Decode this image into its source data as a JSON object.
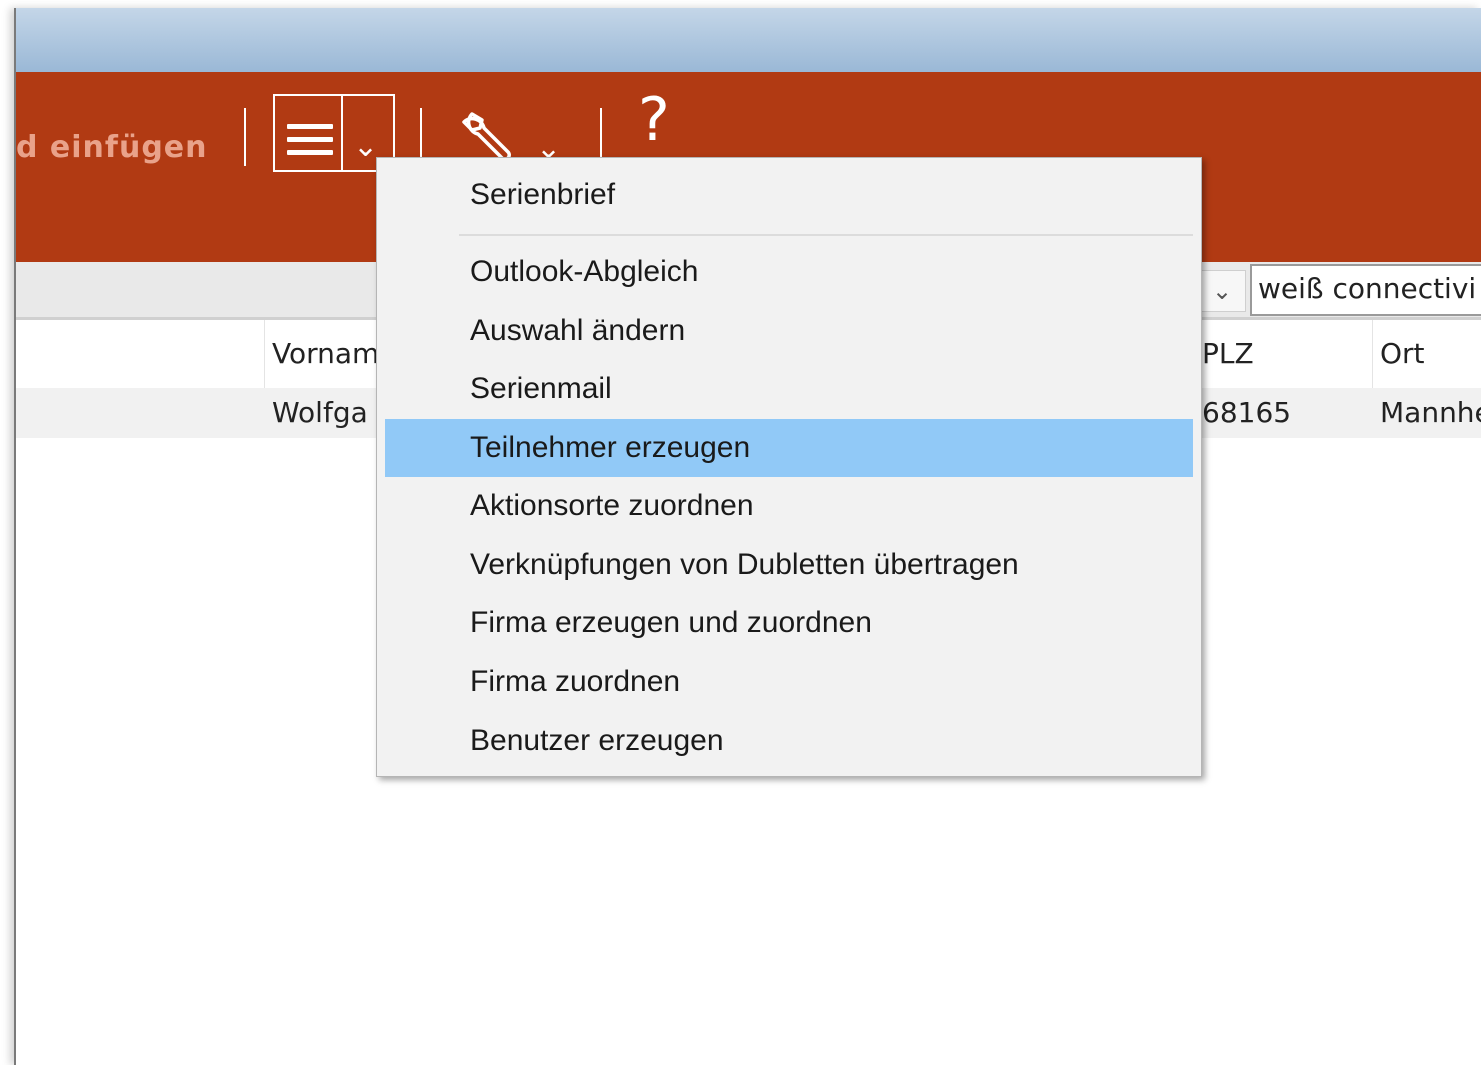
{
  "ribbon": {
    "label": "d einfügen",
    "menu_icon": "hamburger-menu-icon",
    "tools_icon": "wrench-icon",
    "help_label": "?"
  },
  "filter": {
    "dropdown_icon": "chevron-down-icon",
    "search_value": "weiß connectivi"
  },
  "grid": {
    "columns": [
      "Vornam",
      "PLZ",
      "Ort"
    ],
    "rows": [
      [
        "Wolfga",
        "68165",
        "Mannhe"
      ]
    ]
  },
  "popup_menu": {
    "items": [
      {
        "label": "Serienbrief"
      },
      {
        "label": "Outlook-Abgleich"
      },
      {
        "label": "Auswahl ändern"
      },
      {
        "label": "Serienmail"
      },
      {
        "label": "Teilnehmer erzeugen",
        "highlighted": true
      },
      {
        "label": "Aktionsorte zuordnen"
      },
      {
        "label": "Verknüpfungen von Dubletten übertragen"
      },
      {
        "label": "Firma erzeugen und zuordnen"
      },
      {
        "label": "Firma zuordnen"
      },
      {
        "label": "Benutzer erzeugen"
      }
    ]
  },
  "colors": {
    "ribbon": "#b13a13",
    "highlight": "#91c9f7",
    "titlebar": "#9ab8d6"
  }
}
